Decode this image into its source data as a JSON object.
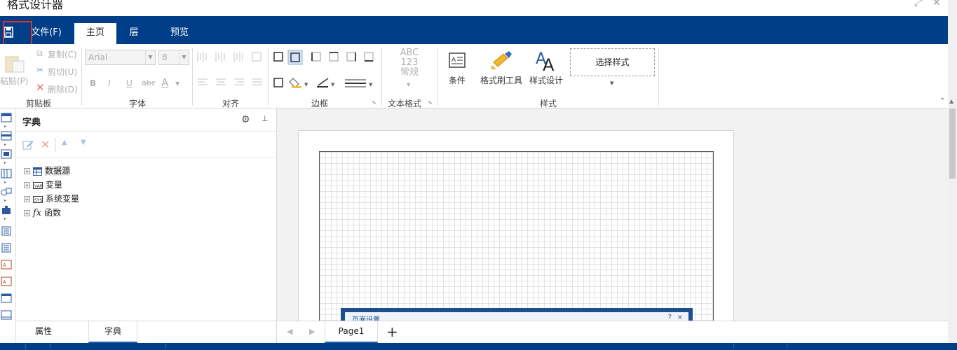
{
  "window": {
    "title": "格式设计器"
  },
  "ribbon_tabs": [
    {
      "label": "文件(F)",
      "active": false
    },
    {
      "label": "主页",
      "active": true
    },
    {
      "label": "层",
      "active": false
    },
    {
      "label": "预览",
      "active": false
    }
  ],
  "clipboard": {
    "paste": "粘贴(P)",
    "copy": "复制(C)",
    "cut": "剪切(U)",
    "delete": "删除(D)",
    "group": "剪贴板"
  },
  "font": {
    "family": "Arial",
    "size": "8",
    "bold": "B",
    "italic": "I",
    "underline": "U",
    "strike": "abc",
    "color": "A",
    "group": "字体"
  },
  "align": {
    "group": "对齐"
  },
  "border": {
    "group": "边框"
  },
  "text_format": {
    "preview_line1": "ABC",
    "preview_line2": "123",
    "preview_line3": "常规",
    "group": "文本格式"
  },
  "styles": {
    "condition": "条件",
    "format_painter": "格式刷工具",
    "style_designer": "样式设计",
    "select_style": "选择样式",
    "group": "样式"
  },
  "dictionary": {
    "title": "字典",
    "items": [
      {
        "label": "数据源",
        "icon": "datasource-icon"
      },
      {
        "label": "变量",
        "icon": "variable-icon"
      },
      {
        "label": "系统变量",
        "icon": "system-variable-icon"
      },
      {
        "label": "函数",
        "icon": "function-icon"
      }
    ],
    "func_glyph": "fx"
  },
  "panel_tabs": [
    {
      "label": "属性",
      "active": false
    },
    {
      "label": "字典",
      "active": true
    }
  ],
  "page_dialog": {
    "title": "页面设置",
    "help": "?",
    "close": "×"
  },
  "page_tabs": {
    "page": "Page1",
    "add": "+"
  },
  "colors": {
    "accent": "#003f88",
    "highlight": "#e03030"
  }
}
